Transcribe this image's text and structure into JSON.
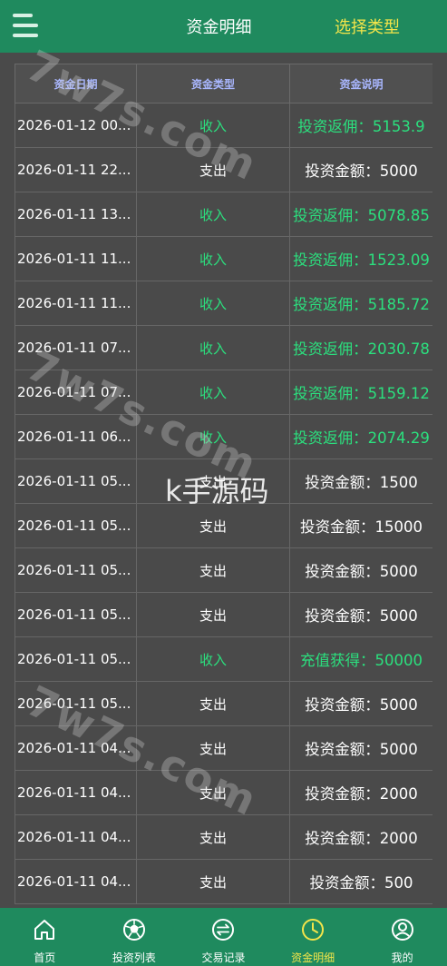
{
  "header": {
    "title": "资金明细",
    "select_type": "选择类型"
  },
  "table": {
    "headers": [
      "资金日期",
      "资金类型",
      "资金说明"
    ],
    "rows": [
      {
        "date": "2026-01-12 00...",
        "type": "收入",
        "desc": "投资返佣：5153.9",
        "kind": "in"
      },
      {
        "date": "2026-01-11 22...",
        "type": "支出",
        "desc": "投资金额：5000",
        "kind": "out"
      },
      {
        "date": "2026-01-11 13...",
        "type": "收入",
        "desc": "投资返佣：5078.85",
        "kind": "in"
      },
      {
        "date": "2026-01-11 11...",
        "type": "收入",
        "desc": "投资返佣：1523.09",
        "kind": "in"
      },
      {
        "date": "2026-01-11 11...",
        "type": "收入",
        "desc": "投资返佣：5185.72",
        "kind": "in"
      },
      {
        "date": "2026-01-11 07...",
        "type": "收入",
        "desc": "投资返佣：2030.78",
        "kind": "in"
      },
      {
        "date": "2026-01-11 07...",
        "type": "收入",
        "desc": "投资返佣：5159.12",
        "kind": "in"
      },
      {
        "date": "2026-01-11 06...",
        "type": "收入",
        "desc": "投资返佣：2074.29",
        "kind": "in"
      },
      {
        "date": "2026-01-11 05...",
        "type": "支出",
        "desc": "投资金额：1500",
        "kind": "out"
      },
      {
        "date": "2026-01-11 05...",
        "type": "支出",
        "desc": "投资金额：15000",
        "kind": "out"
      },
      {
        "date": "2026-01-11 05...",
        "type": "支出",
        "desc": "投资金额：5000",
        "kind": "out"
      },
      {
        "date": "2026-01-11 05...",
        "type": "支出",
        "desc": "投资金额：5000",
        "kind": "out"
      },
      {
        "date": "2026-01-11 05...",
        "type": "收入",
        "desc": "充值获得：50000",
        "kind": "in"
      },
      {
        "date": "2026-01-11 05...",
        "type": "支出",
        "desc": "投资金额：5000",
        "kind": "out"
      },
      {
        "date": "2026-01-11 04...",
        "type": "支出",
        "desc": "投资金额：5000",
        "kind": "out"
      },
      {
        "date": "2026-01-11 04...",
        "type": "支出",
        "desc": "投资金额：2000",
        "kind": "out"
      },
      {
        "date": "2026-01-11 04...",
        "type": "支出",
        "desc": "投资金额：2000",
        "kind": "out"
      },
      {
        "date": "2026-01-11 04...",
        "type": "支出",
        "desc": "投资金额：500",
        "kind": "out"
      }
    ]
  },
  "watermark": {
    "text": "7w7s.com",
    "center_text": "k手源码"
  },
  "tabbar": [
    {
      "label": "首页",
      "icon": "home-icon",
      "active": false
    },
    {
      "label": "投资列表",
      "icon": "ball-icon",
      "active": false
    },
    {
      "label": "交易记录",
      "icon": "exchange-icon",
      "active": false
    },
    {
      "label": "资金明细",
      "icon": "clock-icon",
      "active": true
    },
    {
      "label": "我的",
      "icon": "user-icon",
      "active": false
    }
  ],
  "colors": {
    "header_bg": "#1f8a5e",
    "income": "#2be07e",
    "accent_yellow": "#f3e54a",
    "header_text": "#a9b7ff"
  }
}
